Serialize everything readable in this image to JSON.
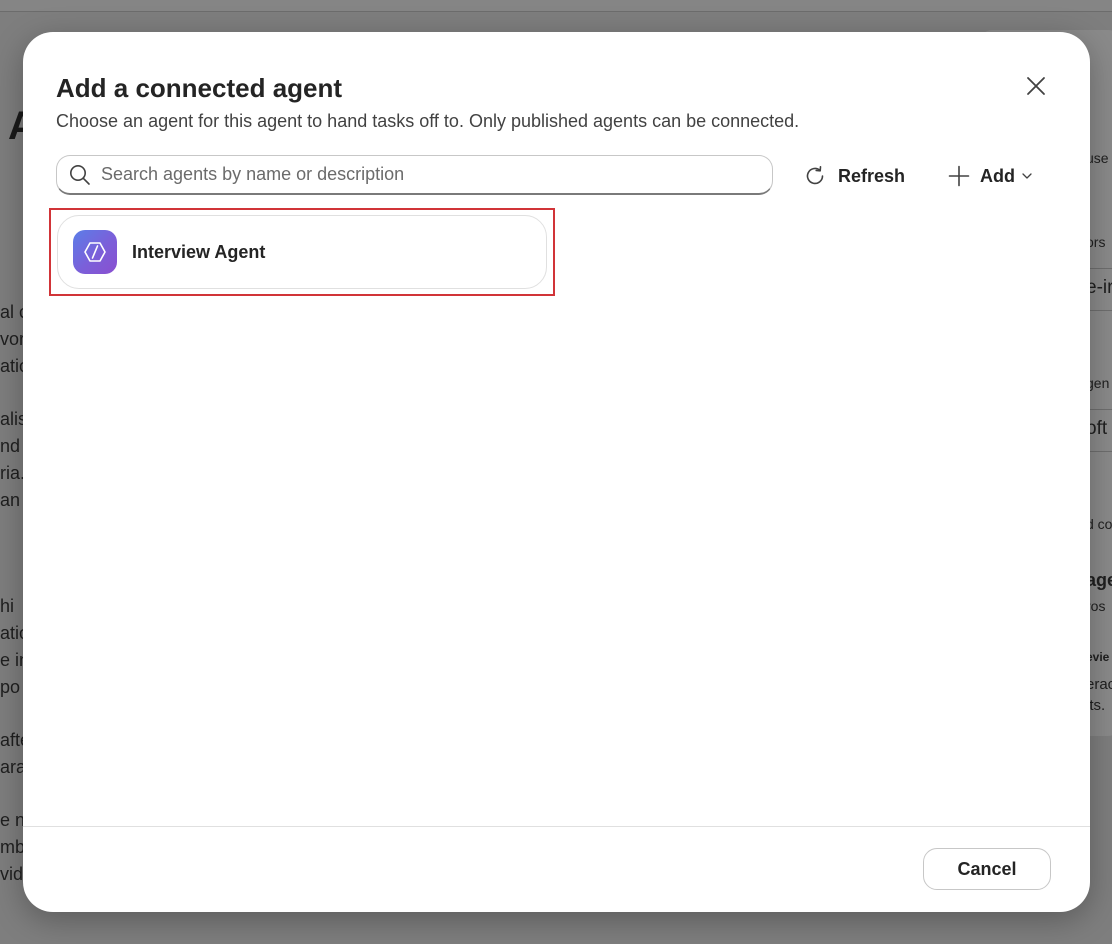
{
  "background": {
    "heading_fragment": "A",
    "left_fragments": [
      "al c",
      "vor",
      "atio",
      "alis",
      "nd a",
      "ria.",
      " an",
      " hi",
      "atio",
      "e in",
      "po",
      "afte",
      "arat",
      "e n",
      "mbe",
      "vide"
    ],
    "right_fragments": [
      "use",
      "ors",
      "e-ir",
      "gen",
      "oft",
      "d co",
      "age",
      "ros",
      "evie",
      "erac",
      "lts."
    ]
  },
  "dialog": {
    "title": "Add a connected agent",
    "subtitle": "Choose an agent for this agent to hand tasks off to. Only published agents can be connected.",
    "close_icon": "close-icon",
    "search": {
      "placeholder": "Search agents by name or description",
      "value": "",
      "icon": "search-icon"
    },
    "toolbar": {
      "refresh_label": "Refresh",
      "refresh_icon": "refresh-icon",
      "add_label": "Add",
      "add_icon": "plus-icon",
      "add_chevron_icon": "chevron-down-icon"
    },
    "agents": [
      {
        "name": "Interview Agent",
        "icon": "code-brackets-icon",
        "highlighted": true
      }
    ],
    "footer": {
      "cancel_label": "Cancel"
    }
  },
  "colors": {
    "highlight": "#d13438",
    "avatar_gradient_start": "#5b7ee8",
    "avatar_gradient_end": "#8a4fd0",
    "backdrop": "#7e7e7e"
  }
}
